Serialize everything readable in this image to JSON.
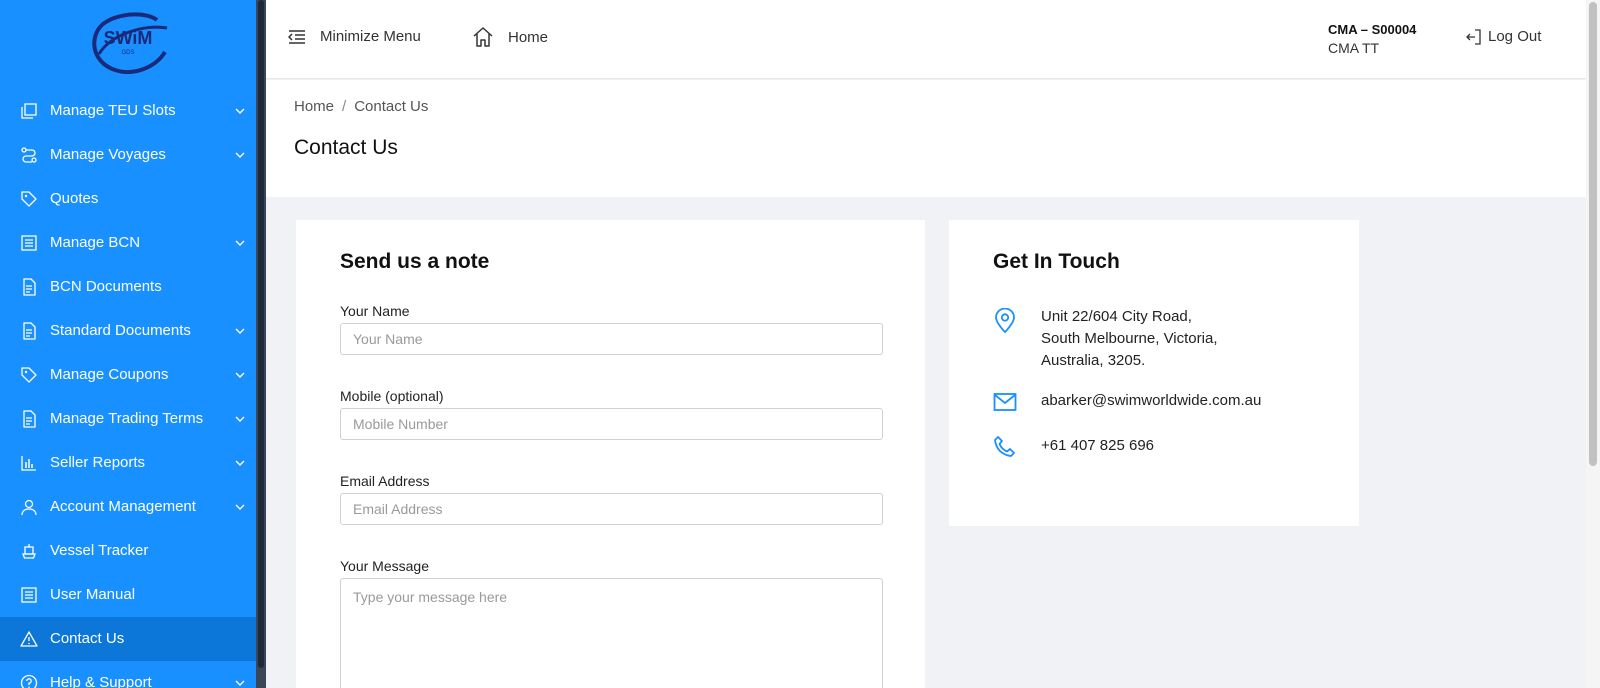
{
  "brand": {
    "logo_text": "SWiM",
    "logo_sub": "GDS"
  },
  "colors": {
    "sidebar": "#1890ff",
    "sidebar_active": "#0d77d9",
    "accent": "#1890ff"
  },
  "sidebar": {
    "items": [
      {
        "label": "Manage TEU Slots",
        "icon": "copy-icon",
        "expandable": true
      },
      {
        "label": "Manage Voyages",
        "icon": "route-icon",
        "expandable": true
      },
      {
        "label": "Quotes",
        "icon": "tag-icon",
        "expandable": false
      },
      {
        "label": "Manage BCN",
        "icon": "list-doc-icon",
        "expandable": true
      },
      {
        "label": "BCN Documents",
        "icon": "document-icon",
        "expandable": false
      },
      {
        "label": "Standard Documents",
        "icon": "document-icon",
        "expandable": true
      },
      {
        "label": "Manage Coupons",
        "icon": "tag-icon",
        "expandable": true
      },
      {
        "label": "Manage Trading Terms",
        "icon": "document-icon",
        "expandable": true
      },
      {
        "label": "Seller Reports",
        "icon": "bar-chart-icon",
        "expandable": true
      },
      {
        "label": "Account Management",
        "icon": "user-icon",
        "expandable": true
      },
      {
        "label": "Vessel Tracker",
        "icon": "ship-icon",
        "expandable": false
      },
      {
        "label": "User Manual",
        "icon": "list-doc-icon",
        "expandable": false
      },
      {
        "label": "Contact Us",
        "icon": "warning-icon",
        "expandable": false,
        "active": true
      },
      {
        "label": "Help & Support",
        "icon": "help-icon",
        "expandable": true
      }
    ]
  },
  "header": {
    "minimize_label": "Minimize Menu",
    "home_label": "Home",
    "user_id": "CMA – S00004",
    "user_name": "CMA TT",
    "logout_label": "Log Out"
  },
  "breadcrumb": {
    "home": "Home",
    "separator": "/",
    "current": "Contact Us"
  },
  "page_title": "Contact Us",
  "note_form": {
    "title": "Send us a note",
    "name_label": "Your Name",
    "name_placeholder": "Your Name",
    "mobile_label": "Mobile (optional)",
    "mobile_placeholder": "Mobile Number",
    "email_label": "Email Address",
    "email_placeholder": "Email Address",
    "message_label": "Your Message",
    "message_placeholder": "Type your message here"
  },
  "touch": {
    "title": "Get In Touch",
    "address_line1": "Unit 22/604 City Road,",
    "address_line2": "South Melbourne, Victoria,",
    "address_line3": "Australia, 3205.",
    "email": "abarker@swimworldwide.com.au",
    "phone": "+61 407 825 696"
  }
}
